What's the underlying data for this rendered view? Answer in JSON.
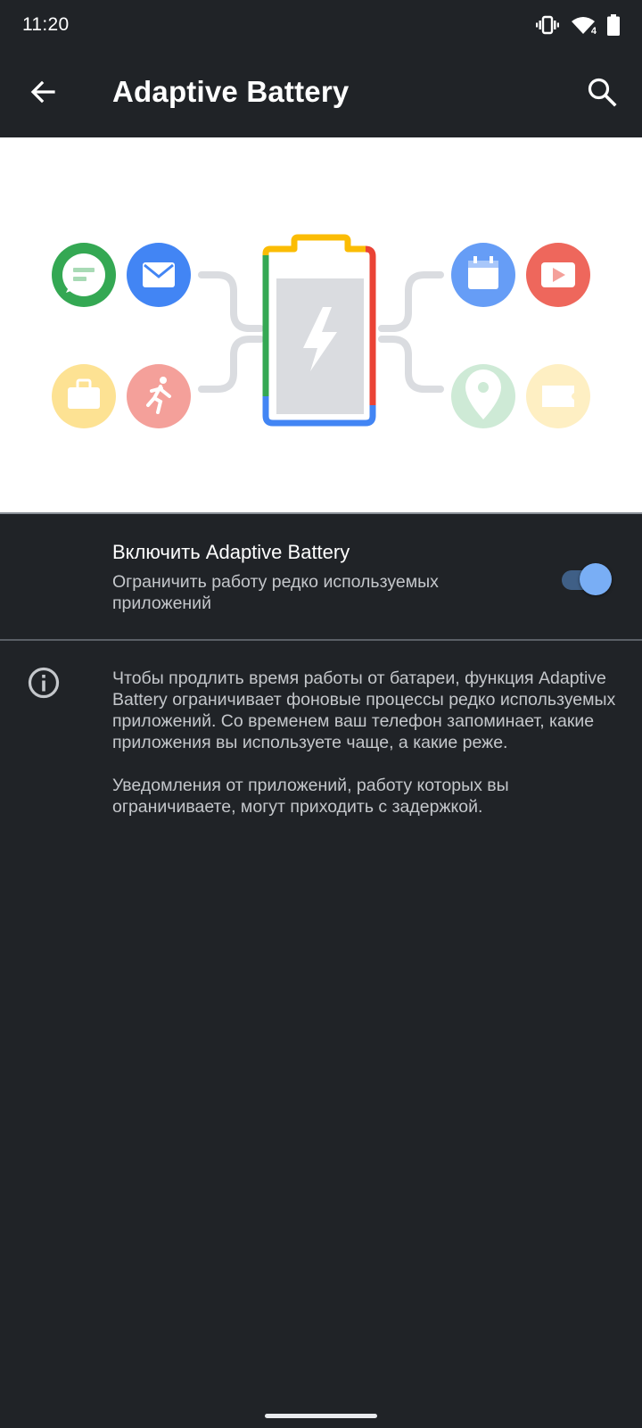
{
  "status_bar": {
    "time": "11:20",
    "icons": [
      "vibrate-icon",
      "wifi-icon",
      "battery-icon"
    ],
    "wifi_badge": "4"
  },
  "app_bar": {
    "title": "Adaptive Battery",
    "back_icon": "arrow-back-icon",
    "search_icon": "search-icon"
  },
  "illustration": {
    "left_icons": [
      "chat-icon",
      "mail-icon",
      "briefcase-icon",
      "run-icon"
    ],
    "right_icons": [
      "calendar-icon",
      "video-icon",
      "location-icon",
      "ticket-icon"
    ],
    "center_icon": "battery-bolt-icon"
  },
  "toggle": {
    "title": "Включить Adaptive Battery",
    "summary": "Ограничить работу редко используемых приложений",
    "checked": true,
    "accent_color": "#79aef5"
  },
  "info": {
    "icon": "info-icon",
    "paragraphs": [
      "Чтобы продлить время работы от батареи, функция Adaptive Battery ограничивает фоновые процессы редко используемых приложений. Со временем ваш телефон запоминает, какие приложения вы используете чаще, а какие реже.",
      "Уведомления от приложений, работу которых вы ограничиваете, могут приходить с задержкой."
    ]
  },
  "colors": {
    "background": "#202327",
    "green": "#34a853",
    "blue": "#4285f4",
    "yellow": "#fbbc04",
    "red": "#ea4335"
  }
}
